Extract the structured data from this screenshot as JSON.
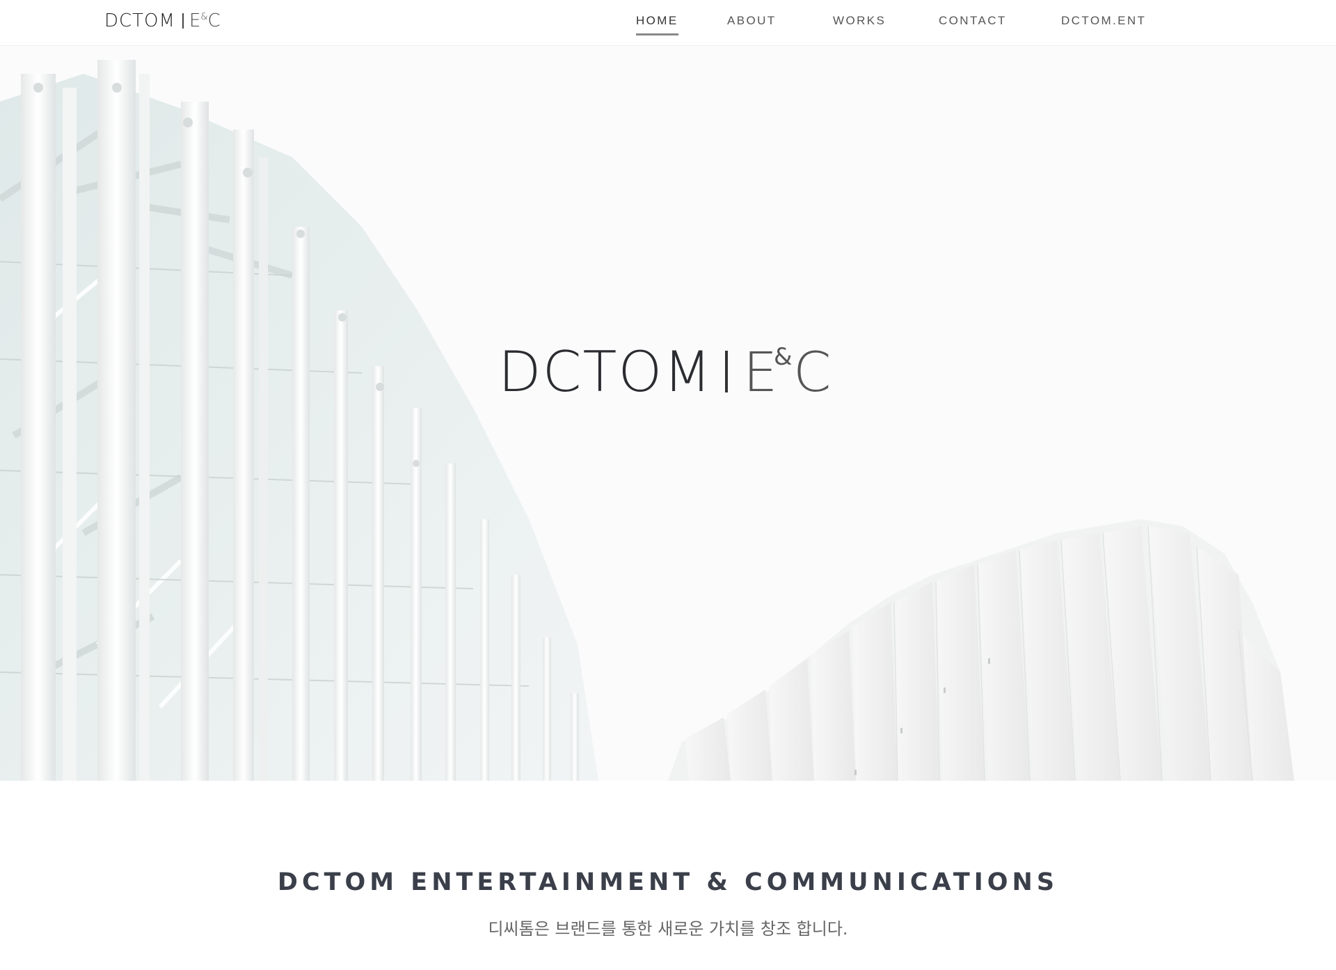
{
  "header": {
    "logo": {
      "word": "DCTOM",
      "ec_e": "E",
      "ec_amp": "&",
      "ec_c": "C"
    },
    "nav": [
      {
        "label": "HOME",
        "active": true
      },
      {
        "label": "ABOUT",
        "active": false
      },
      {
        "label": "WORKS",
        "active": false
      },
      {
        "label": "CONTACT",
        "active": false
      },
      {
        "label": "DCTOM.ENT",
        "active": false
      }
    ]
  },
  "hero": {
    "logo": {
      "word": "DCTOM",
      "ec_e": "E",
      "ec_amp": "&",
      "ec_c": "C"
    }
  },
  "intro": {
    "title": "DCTOM ENTERTAINMENT & COMMUNICATIONS",
    "subtitle": "디씨톰은 브랜드를 통한 새로운 가치를 창조 합니다."
  },
  "colors": {
    "text_dark": "#333333",
    "nav_text": "#555555",
    "title_text": "#3a3f4a",
    "hero_bg": "#fbfbfc"
  }
}
